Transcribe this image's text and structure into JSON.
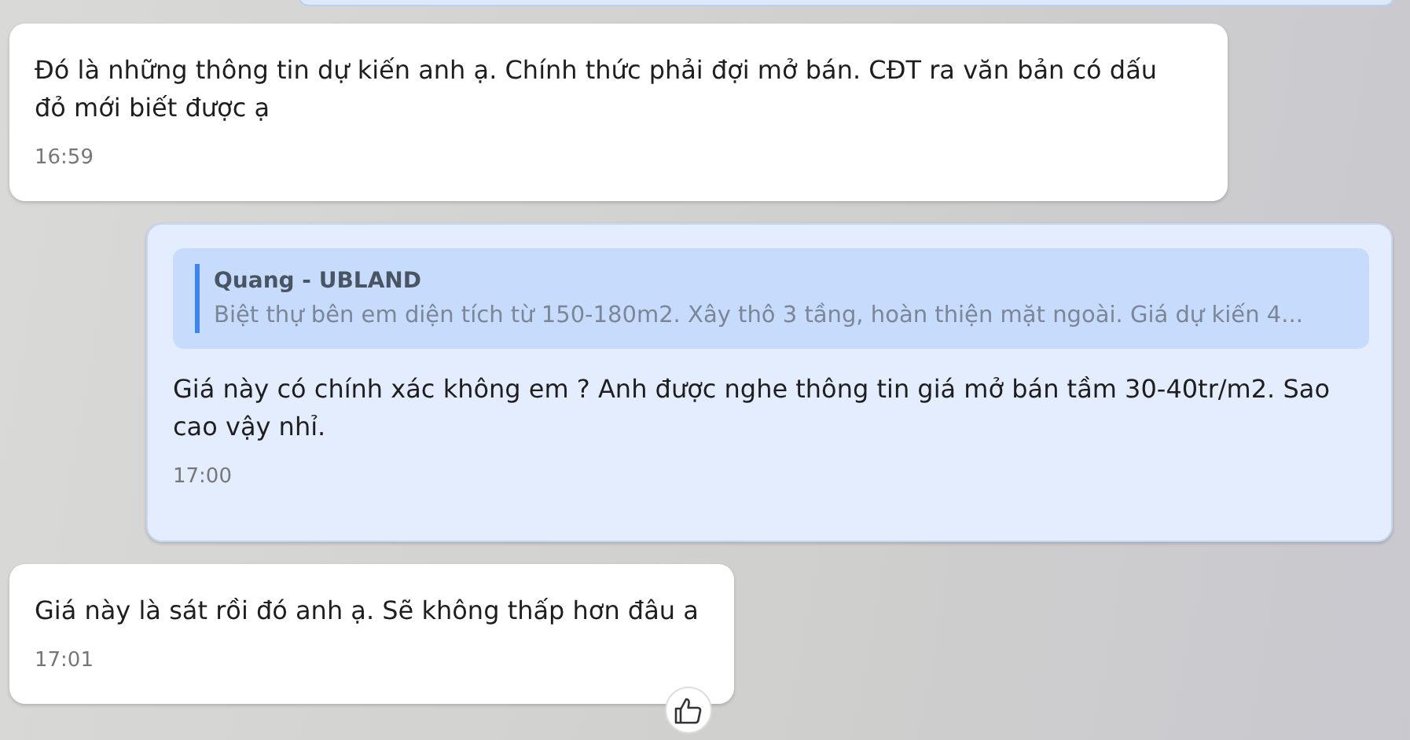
{
  "messages": [
    {
      "kind": "incoming",
      "text": "Đó là những thông tin dự kiến anh ạ. Chính thức phải đợi mở bán. CĐT ra văn bản có dấu đỏ mới biết được ạ",
      "time": "16:59"
    },
    {
      "kind": "outgoing",
      "quote": {
        "author": "Quang - UBLAND",
        "text": "Biệt thự bên em diện tích từ 150-180m2. Xây thô 3 tầng, hoàn thiện mặt ngoài. Giá dự kiến 4..."
      },
      "text": "Giá này có chính xác không em ? Anh được nghe thông tin giá mở bán tầm 30-40tr/m2. Sao cao vậy nhỉ.",
      "time": "17:00"
    },
    {
      "kind": "incoming",
      "text": "Giá này là sát rồi đó anh ạ. Sẽ không thấp hơn đâu a",
      "time": "17:01",
      "like_button": true
    }
  ]
}
